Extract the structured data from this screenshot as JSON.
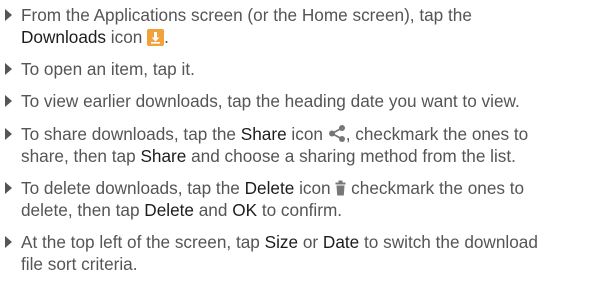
{
  "items": [
    {
      "line1_a": "From the Applications screen (or the Home screen), tap the",
      "line2_strong": "Downloads",
      "line2_b": " icon ",
      "line2_c": ".",
      "icon": "download-icon"
    },
    {
      "text": "To open an item, tap it."
    },
    {
      "text": "To view earlier downloads, tap the heading date you want to view."
    },
    {
      "line1_a": "To share downloads, tap the ",
      "line1_strong1": "Share",
      "line1_b": " icon ",
      "line1_c": ", checkmark the ones to",
      "line2_a": "share, then tap ",
      "line2_strong1": "Share",
      "line2_b": " and choose a sharing method from the list.",
      "icon": "share-icon"
    },
    {
      "line1_a": "To delete downloads, tap the ",
      "line1_strong1": "Delete",
      "line1_b": " icon ",
      "line1_c": " checkmark the ones to",
      "line2_a": "delete, then tap ",
      "line2_strong1": "Delete",
      "line2_b": " and ",
      "line2_strong2": "OK",
      "line2_c": " to confirm.",
      "icon": "trash-icon"
    },
    {
      "line1_a": "At the top left of the screen, tap ",
      "line1_strong1": "Size",
      "line1_b": " or ",
      "line1_strong2": "Date",
      "line1_c": " to switch the download",
      "line2_a": "file sort criteria."
    }
  ],
  "colors": {
    "text": "#555555",
    "emphasis": "#1c1c1c",
    "download_icon_bg": "#f2a23a"
  }
}
